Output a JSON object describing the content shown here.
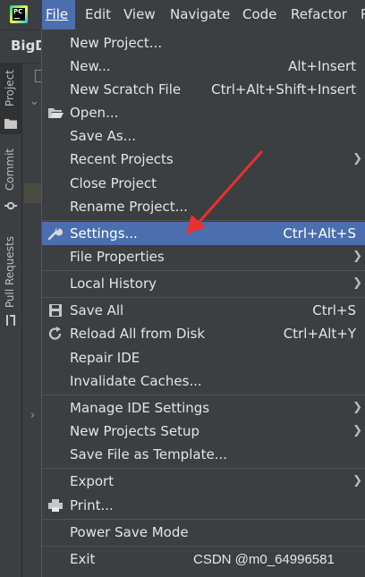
{
  "menubar": {
    "items": [
      {
        "label": "File"
      },
      {
        "label": "Edit"
      },
      {
        "label": "View"
      },
      {
        "label": "Navigate"
      },
      {
        "label": "Code"
      },
      {
        "label": "Refactor"
      },
      {
        "label": "R"
      }
    ]
  },
  "project": {
    "title": "BigD"
  },
  "toolstrip": {
    "tabs": [
      {
        "label": "Project"
      },
      {
        "label": "Commit"
      },
      {
        "label": "Pull Requests"
      }
    ]
  },
  "file_menu": {
    "items": [
      {
        "label": "New Project...",
        "shortcut": ""
      },
      {
        "label": "New...",
        "shortcut": "Alt+Insert"
      },
      {
        "label": "New Scratch File",
        "shortcut": "Ctrl+Alt+Shift+Insert"
      },
      {
        "label": "Open...",
        "shortcut": ""
      },
      {
        "label": "Save As...",
        "shortcut": ""
      },
      {
        "label": "Recent Projects",
        "shortcut": ""
      },
      {
        "label": "Close Project",
        "shortcut": ""
      },
      {
        "label": "Rename Project...",
        "shortcut": ""
      },
      {
        "label": "Settings...",
        "shortcut": "Ctrl+Alt+S"
      },
      {
        "label": "File Properties",
        "shortcut": ""
      },
      {
        "label": "Local History",
        "shortcut": ""
      },
      {
        "label": "Save All",
        "shortcut": "Ctrl+S"
      },
      {
        "label": "Reload All from Disk",
        "shortcut": "Ctrl+Alt+Y"
      },
      {
        "label": "Repair IDE",
        "shortcut": ""
      },
      {
        "label": "Invalidate Caches...",
        "shortcut": ""
      },
      {
        "label": "Manage IDE Settings",
        "shortcut": ""
      },
      {
        "label": "New Projects Setup",
        "shortcut": ""
      },
      {
        "label": "Save File as Template...",
        "shortcut": ""
      },
      {
        "label": "Export",
        "shortcut": ""
      },
      {
        "label": "Print...",
        "shortcut": ""
      },
      {
        "label": "Power Save Mode",
        "shortcut": ""
      },
      {
        "label": "Exit",
        "shortcut": ""
      }
    ],
    "selected": "Settings..."
  },
  "watermark": {
    "text": "CSDN @m0_64996581"
  },
  "colors": {
    "background": "#3c3f41",
    "selection": "#4b6eaf",
    "text": "#e4e4e4",
    "annotation_arrow": "#e8312f"
  },
  "icons": [
    "pycharm-logo-icon",
    "folder-icon",
    "wrench-icon",
    "floppy-disk-icon",
    "reload-icon",
    "printer-icon",
    "chevron-right-icon",
    "commit-icon",
    "pull-request-icon"
  ]
}
